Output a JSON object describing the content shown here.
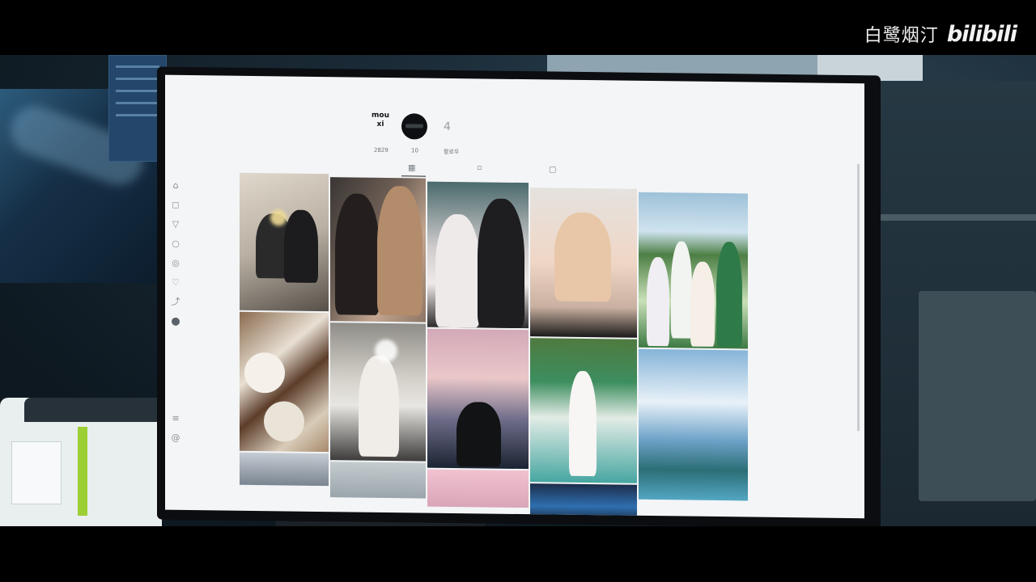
{
  "watermark": {
    "channel": "白鹭烟汀",
    "logo": "bilibili"
  },
  "profile": {
    "logo_text": "mou\nxi",
    "stats": [
      {
        "label": "2829"
      },
      {
        "label": "10"
      },
      {
        "label": "팔로우"
      }
    ],
    "stat_number": "4"
  },
  "tabs": [
    "grid-icon",
    "bookmark-icon",
    "tagged-icon"
  ],
  "nav_icons": [
    "home-icon",
    "instagram-icon",
    "filter-icon",
    "search-icon",
    "explore-icon",
    "heart-icon",
    "send-icon",
    "profile-avatar",
    "menu-icon",
    "threads-icon"
  ],
  "photos": [
    "couple in school uniforms",
    "couple selfie",
    "couple with peace sign",
    "portrait selfie",
    "group golf photo",
    "cafe table food",
    "mirror selfie",
    "sunset pool",
    "tennis court",
    "ocean infinity pool",
    "screen photo",
    "photo",
    "pink photo",
    "blue photo"
  ],
  "colors": {
    "screen_bg": "#f3f5f6",
    "letterbox": "#000000",
    "printer_accent": "#9ccf34"
  }
}
